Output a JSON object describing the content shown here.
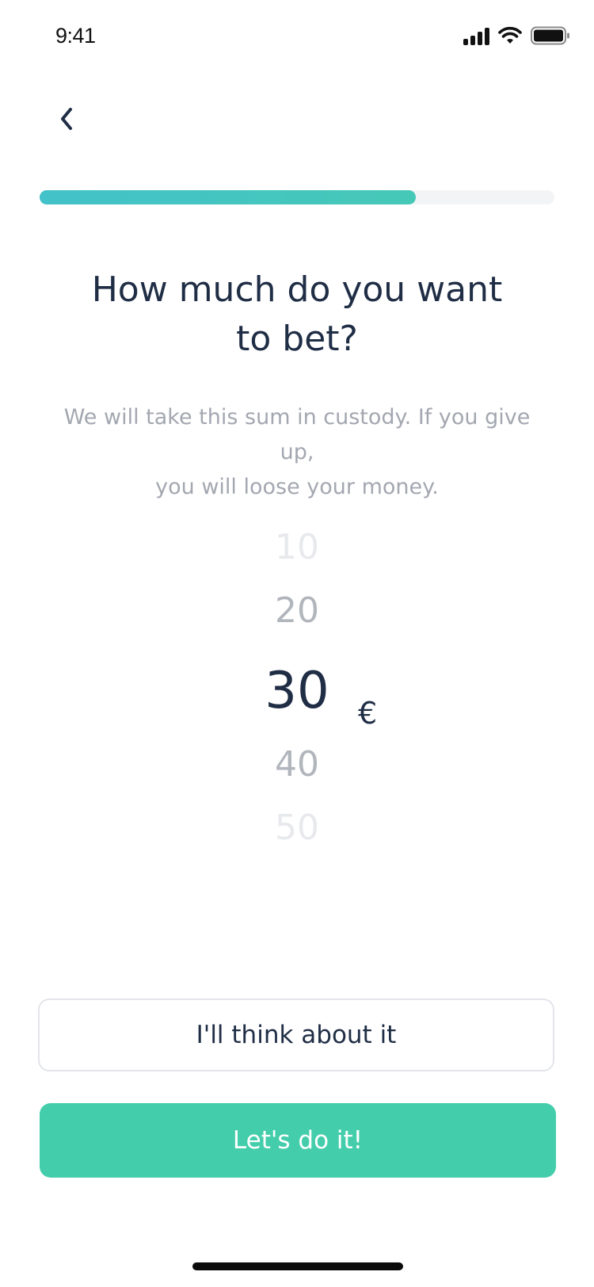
{
  "status_bar": {
    "time": "9:41",
    "icons": [
      "signal-icon",
      "wifi-icon",
      "battery-icon"
    ]
  },
  "nav": {
    "back_icon": "chevron-left-icon"
  },
  "progress": {
    "value_percent": 73,
    "colors": [
      "#43c2c9",
      "#46c8b7"
    ]
  },
  "title": {
    "line1": "How much do you want",
    "line2": "to bet?"
  },
  "subtitle": {
    "line1": "We will take this sum in custody. If you give up,",
    "line2": "you will loose your money."
  },
  "picker": {
    "options": [
      "10",
      "20",
      "30",
      "40",
      "50"
    ],
    "selected": "30",
    "currency": "€"
  },
  "actions": {
    "secondary_label": "I'll think about it",
    "primary_label": "Let's do it!",
    "primary_color": "#44cdab"
  }
}
